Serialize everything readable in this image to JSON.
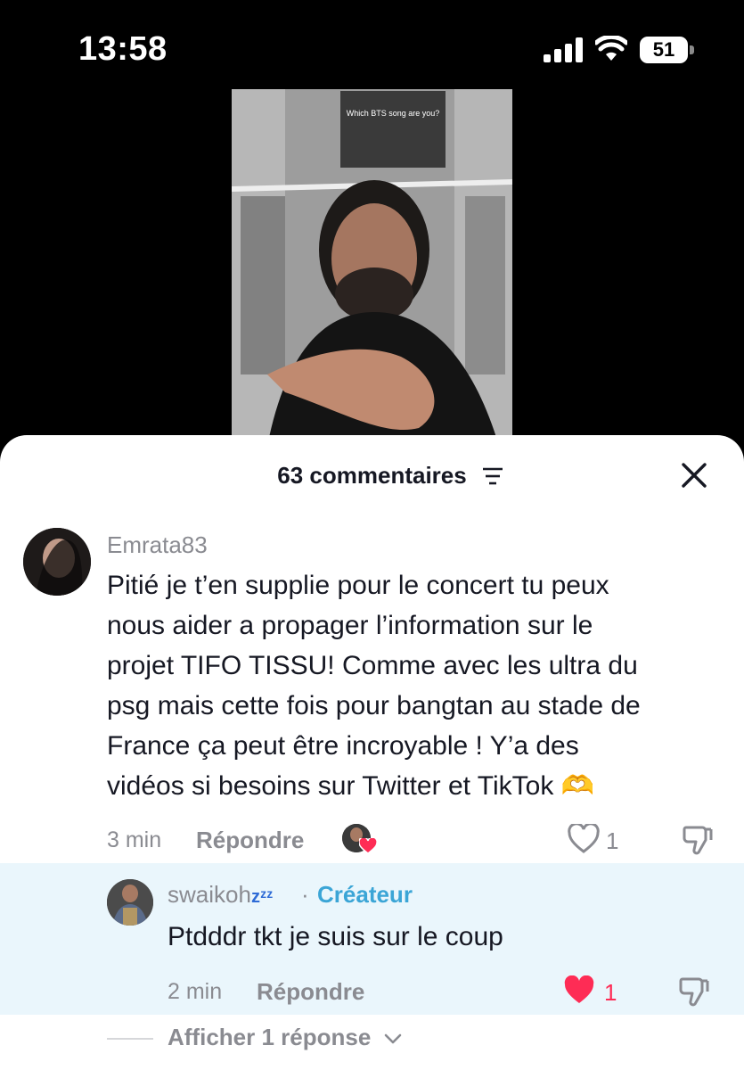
{
  "status_bar": {
    "time": "13:58",
    "battery": "51",
    "icons": [
      "signal-icon",
      "wifi-icon",
      "battery-icon"
    ]
  },
  "video": {
    "sticker_text": "Which BTS song are you?"
  },
  "comments_sheet": {
    "title": "63 commentaires",
    "icons": [
      "sort-icon",
      "close-icon"
    ]
  },
  "comment": {
    "username": "Emrata83",
    "lines": [
      "Pitié je t’en supplie pour le concert tu peux",
      "nous aider a propager l’information sur le",
      "projet TIFO TISSU! Comme avec les ultra du",
      "psg mais cette fois pour bangtan au stade de",
      "France ça peut être incroyable ! Y’a des",
      "vidéos si besoins sur Twitter et TikTok 🫶"
    ],
    "time": "3 min",
    "reply_label": "Répondre",
    "likes": "1"
  },
  "reply": {
    "username": "swaikoh",
    "username_suffix": "zᶻᶻ",
    "separator": "·",
    "creator_label": "Créateur",
    "text": "Ptdddr tkt je suis sur le coup",
    "time": "2 min",
    "reply_label": "Répondre",
    "likes": "1",
    "like_color": "#fe2c55"
  },
  "more": {
    "label": "Afficher 1 réponse"
  }
}
